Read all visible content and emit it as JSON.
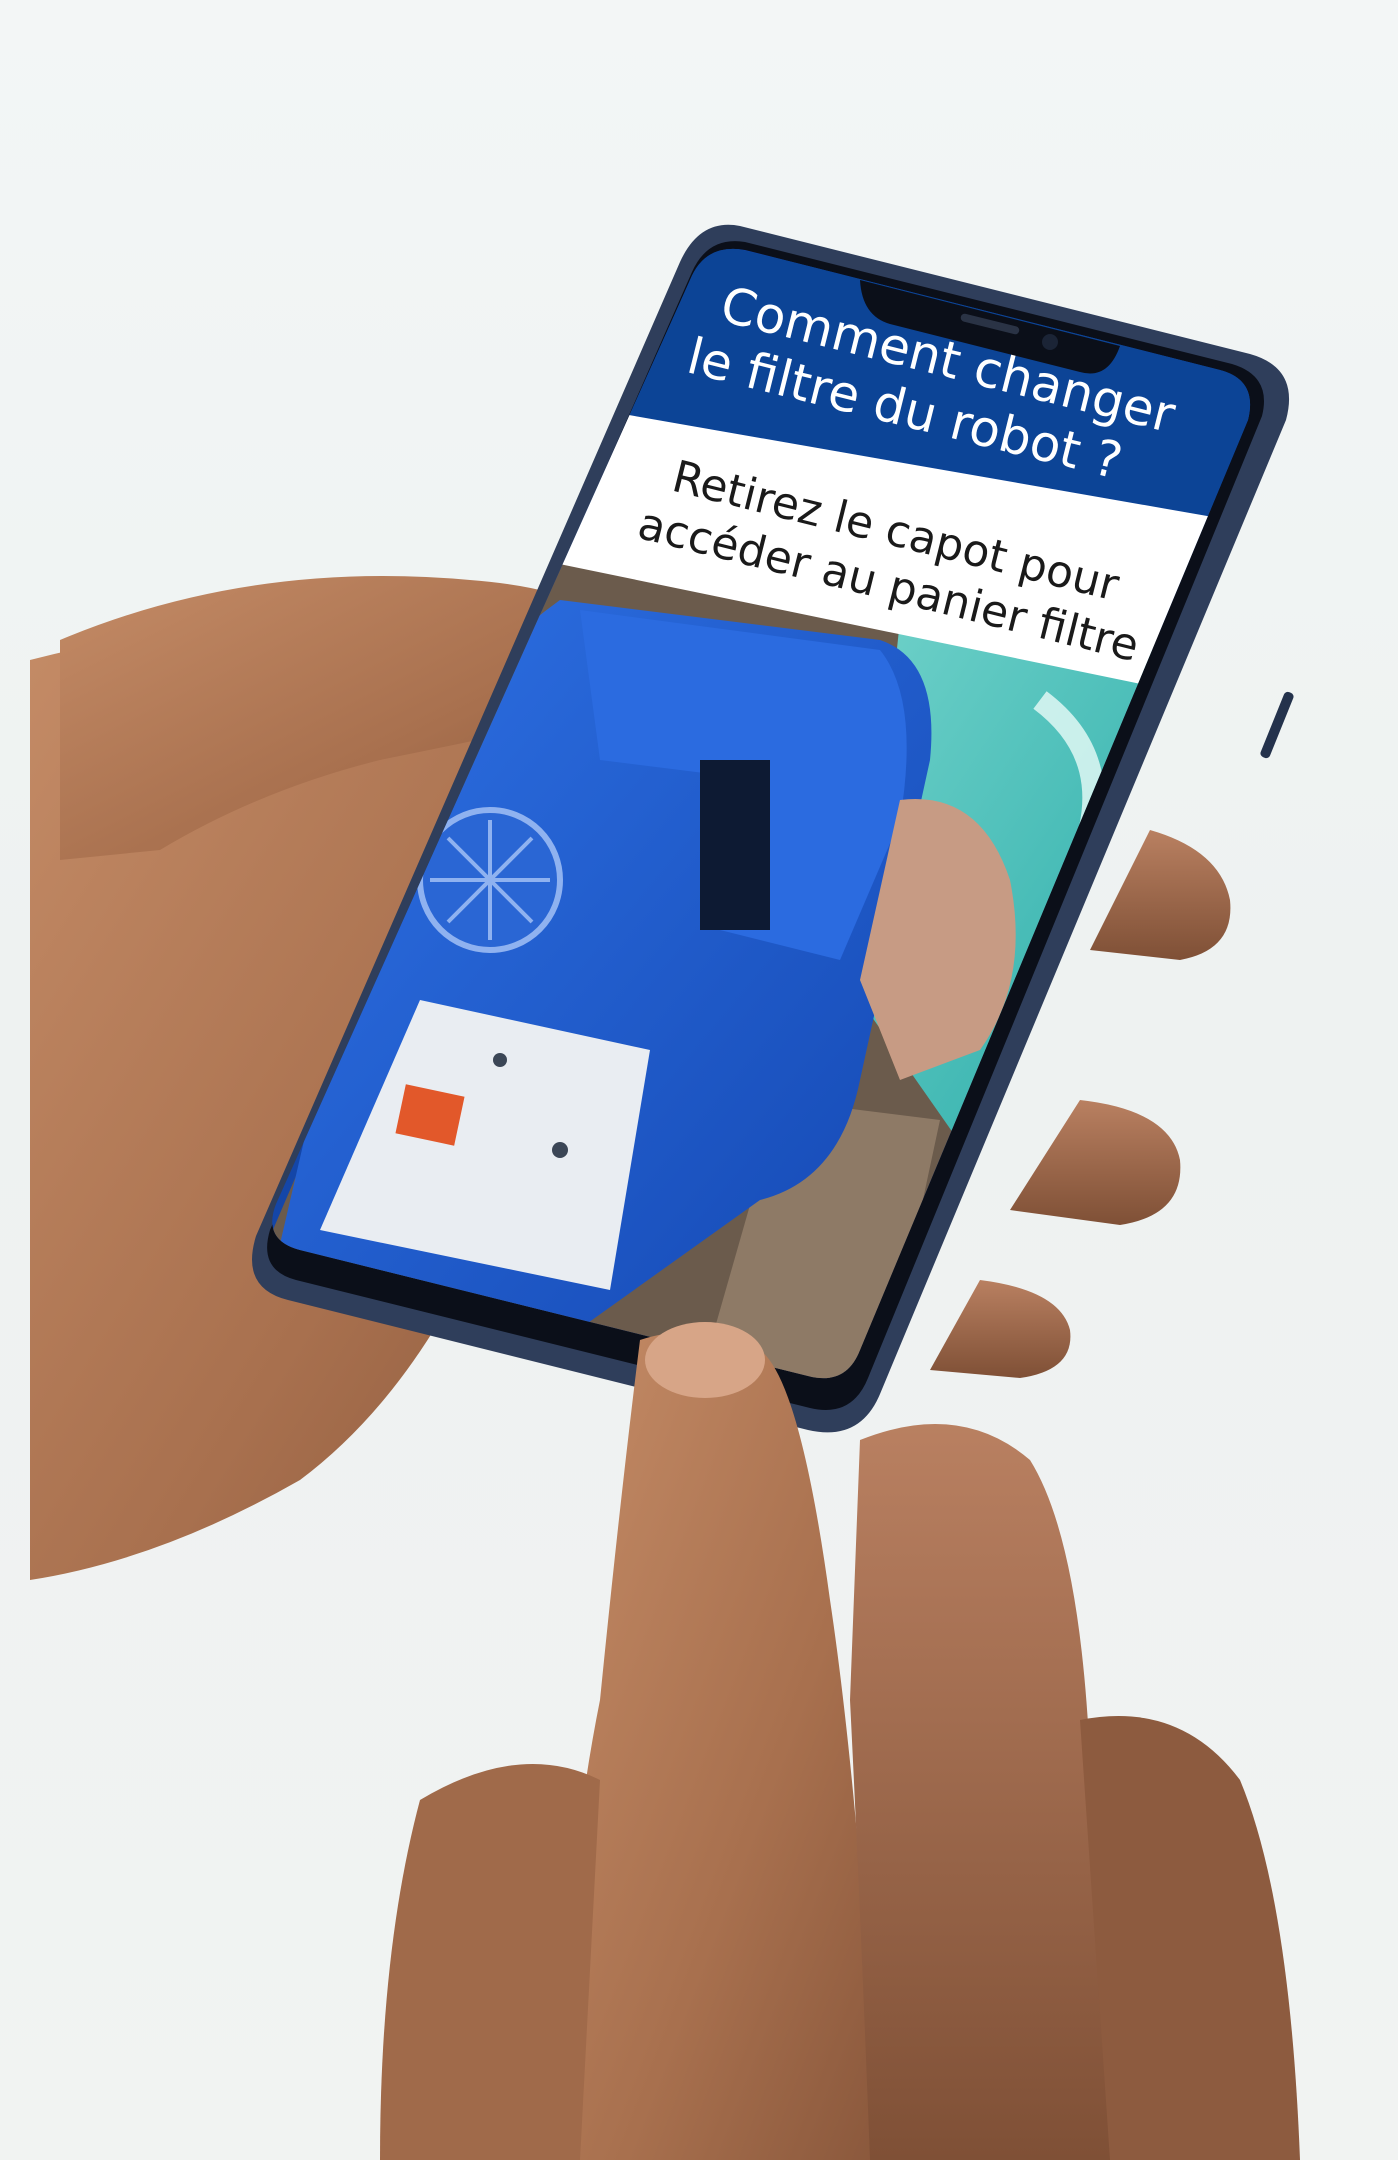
{
  "screen": {
    "header_title_line1": "Comment changer",
    "header_title_line2": "le filtre du robot ?",
    "instruction_line1": "Retirez le capot pour",
    "instruction_line2": "accéder au panier filtre"
  },
  "colors": {
    "header_blue": "#0c4496",
    "phone_frame": "#2f3e5b",
    "robot_blue": "#1f5fd6",
    "water_turquoise": "#2bb7b2",
    "skin": "#b07a58"
  },
  "icon_names": [
    "front-camera-icon",
    "earpiece-speaker-icon"
  ]
}
